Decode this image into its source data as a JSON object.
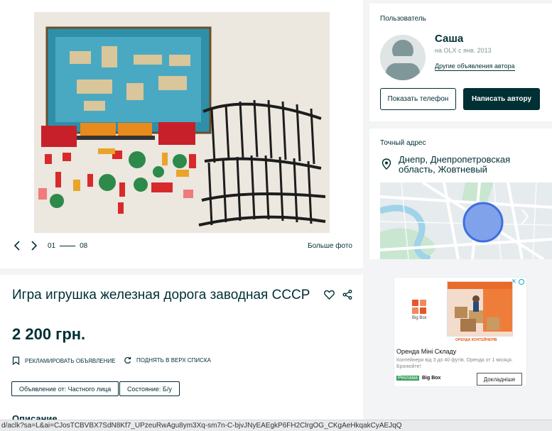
{
  "gallery": {
    "counter_current": "01",
    "counter_total": "08",
    "big_photo_label": "Больше фото"
  },
  "user": {
    "section_title": "Пользователь",
    "name": "Саша",
    "since": "на OLX с янв. 2013",
    "other_ads": "Другие объявления автора",
    "show_phone": "Показать телефон",
    "write_author": "Написать автору"
  },
  "location": {
    "section_title": "Точный адрес",
    "address": "Днепр, Днепропетровская область, Жовтневый"
  },
  "ad": {
    "title": "Игра игрушка железная дорога заводная СССР",
    "price": "2 200 грн.",
    "promote": "РЕКЛАМИРОВАТЬ ОБЪЯВЛЕНИЕ",
    "raise": "ПОДНЯТЬ В ВЕРХ СПИСКА",
    "tag_seller": "Объявление от: Частного лица",
    "tag_state": "Состояние: Б/у",
    "description_title": "Описание"
  },
  "banner": {
    "brand_small": "Big Box",
    "image_caption": "ОРЕНДА КОНТЕЙНЕРІВ",
    "headline": "Оренда Міні Складу",
    "body": "Контейнери від 3 до 40 футів. Оренда от 1 місяця. Бронюйте!",
    "badge": "Реклама",
    "advertiser": "Big Box",
    "cta": "Докладніше",
    "close": "✕"
  },
  "statusbar": {
    "url": "d/aclk?sa=L&ai=CJosTCBVBX7SdN8Kf7_UPzeuRwAgu8ym3Xq-sm7n-C-bjvJNyEAEgkP6FH2ClrgOG_CKgAeHkqakCyAEJqQ"
  },
  "colors": {
    "brand": "#002f34",
    "map_accent": "#3f6ede",
    "ad_badge": "#3a9f5e"
  }
}
